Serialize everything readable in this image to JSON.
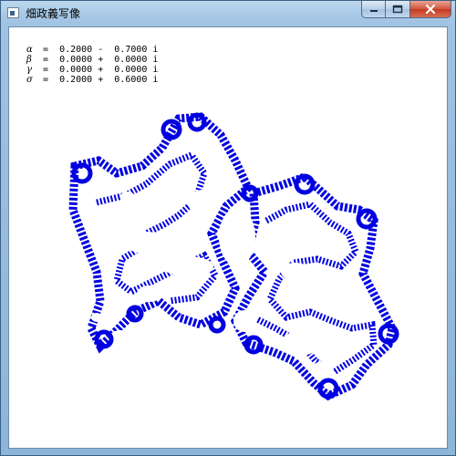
{
  "window": {
    "title": "畑政義写像",
    "buttons": {
      "minimize": "minimize-icon",
      "maximize": "maximize-icon",
      "close": "close-icon"
    }
  },
  "parameters": [
    {
      "symbol": "α",
      "text": " =  0.2000 -  0.7000 i"
    },
    {
      "symbol": "β",
      "text": " =  0.0000 +  0.0000 i"
    },
    {
      "symbol": "γ",
      "text": " =  0.0000 +  0.0000 i"
    },
    {
      "symbol": "σ",
      "text": " =  0.2000 +  0.6000 i"
    }
  ],
  "fractal": {
    "color": "#0000e0",
    "dot_color": "#0000e0"
  }
}
